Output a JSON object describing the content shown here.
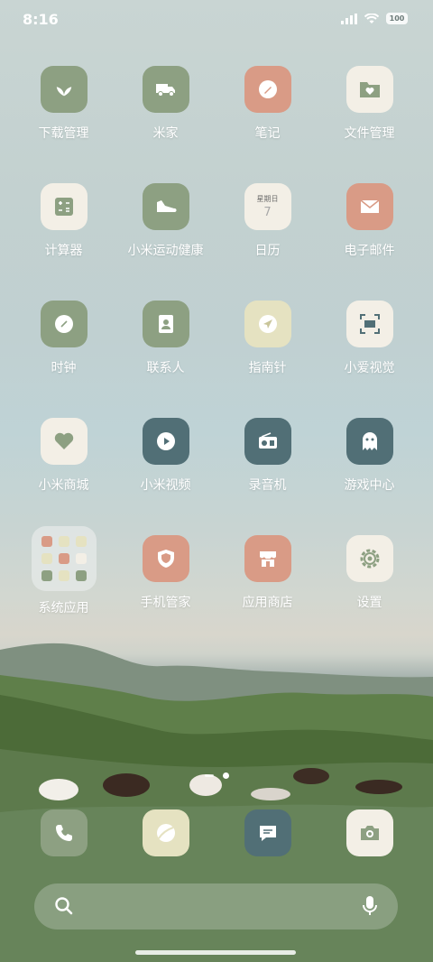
{
  "status": {
    "time": "8:16",
    "battery": "100"
  },
  "apps": [
    {
      "label": "下载管理",
      "icon": "leaf-icon",
      "bg": "#8da082"
    },
    {
      "label": "米家",
      "icon": "truck-icon",
      "bg": "#8da082"
    },
    {
      "label": "笔记",
      "icon": "pen-icon",
      "bg": "#d99b86"
    },
    {
      "label": "文件管理",
      "icon": "folder-heart-icon",
      "bg": "#f3efe6"
    },
    {
      "label": "计算器",
      "icon": "calculator-icon",
      "bg": "#f3efe6"
    },
    {
      "label": "小米运动健康",
      "icon": "shoe-icon",
      "bg": "#8da082"
    },
    {
      "label": "日历",
      "icon": "calendar-icon",
      "bg": "#f3efe6",
      "calendar_day": "星期日",
      "calendar_date": "7"
    },
    {
      "label": "电子邮件",
      "icon": "mail-icon",
      "bg": "#d99b86"
    },
    {
      "label": "时钟",
      "icon": "clock-icon",
      "bg": "#8da082"
    },
    {
      "label": "联系人",
      "icon": "contact-icon",
      "bg": "#8da082"
    },
    {
      "label": "指南针",
      "icon": "compass-icon",
      "bg": "#e5e2c1"
    },
    {
      "label": "小爱视觉",
      "icon": "scan-icon",
      "bg": "#f3efe6"
    },
    {
      "label": "小米商城",
      "icon": "heart-icon",
      "bg": "#f3efe6"
    },
    {
      "label": "小米视频",
      "icon": "play-icon",
      "bg": "#516f76"
    },
    {
      "label": "录音机",
      "icon": "radio-icon",
      "bg": "#516f76"
    },
    {
      "label": "游戏中心",
      "icon": "ghost-icon",
      "bg": "#516f76"
    },
    {
      "label": "系统应用",
      "icon": "folder-icon",
      "bg": "folder"
    },
    {
      "label": "手机管家",
      "icon": "shield-icon",
      "bg": "#d99b86"
    },
    {
      "label": "应用商店",
      "icon": "store-icon",
      "bg": "#d99b86"
    },
    {
      "label": "设置",
      "icon": "gear-icon",
      "bg": "#f3efe6"
    }
  ],
  "dock": [
    {
      "name": "phone",
      "icon": "phone-icon",
      "bg": "#8da082"
    },
    {
      "name": "browser",
      "icon": "browser-icon",
      "bg": "#e5e2c1"
    },
    {
      "name": "messages",
      "icon": "message-icon",
      "bg": "#516f76"
    },
    {
      "name": "camera",
      "icon": "camera-icon",
      "bg": "#f3efe6"
    }
  ],
  "colors": {
    "sage": "#8da082",
    "salmon": "#d99b86",
    "cream": "#f3efe6",
    "teal": "#516f76",
    "butter": "#e5e2c1"
  }
}
